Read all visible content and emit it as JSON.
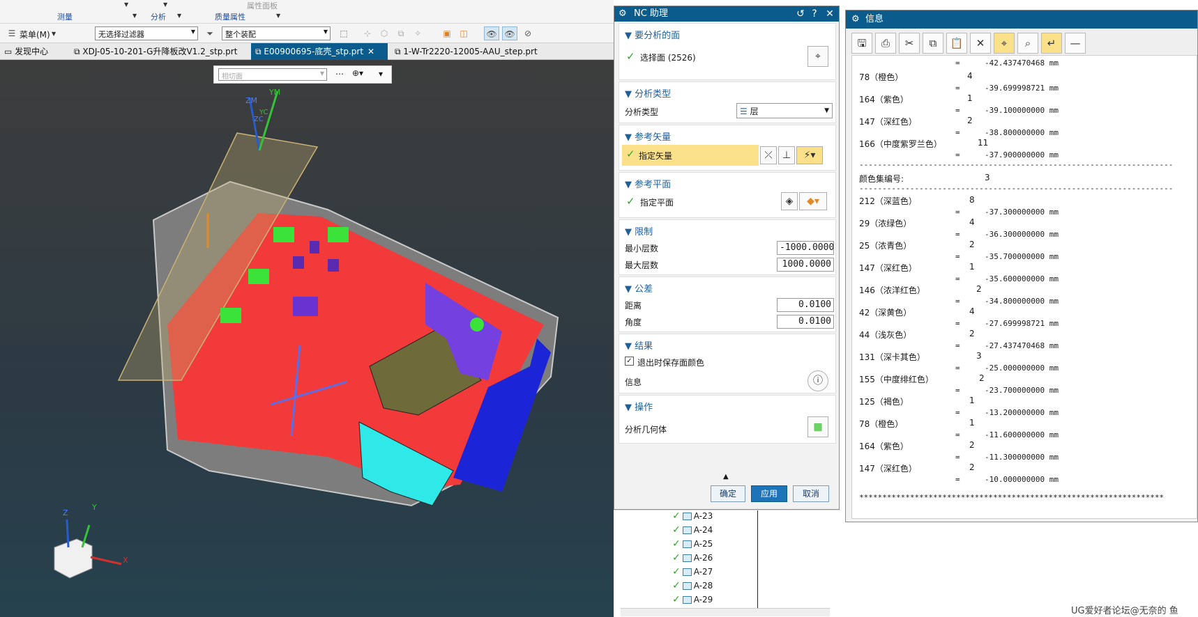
{
  "ribbon": {
    "groups": {
      "measure": "测量",
      "analysis": "分析",
      "mass": "质量属性",
      "props_panel": "属性面板"
    }
  },
  "toolbar": {
    "menu": "菜单(M)",
    "filter": "无选择过滤器",
    "assembly": "整个装配"
  },
  "tabs": [
    {
      "label": "发现中心"
    },
    {
      "label": "XDJ-05-10-201-G升降板改V1.2_stp.prt"
    },
    {
      "label": "E00900695-底壳_stp.prt"
    },
    {
      "label": "1-W-Tr2220-12005-AAU_step.prt"
    }
  ],
  "viewport": {
    "face_select": "相切面",
    "triad": {
      "zm": "ZM",
      "ym": "YM",
      "zc": "ZC",
      "yc": "YC",
      "x": "X",
      "y": "Y",
      "z": "Z"
    }
  },
  "nc_dialog": {
    "title": "NC 助理",
    "sec_faces": "要分析的面",
    "sel_faces": "选择面 (2526)",
    "sec_type": "分析类型",
    "type_label": "分析类型",
    "type_value": "层",
    "sec_vec": "参考矢量",
    "vec_label": "指定矢量",
    "sec_plane": "参考平面",
    "plane_label": "指定平面",
    "sec_limit": "限制",
    "min_label": "最小层数",
    "min_value": "-1000.0000",
    "max_label": "最大层数",
    "max_value": "1000.0000",
    "sec_tol": "公差",
    "dist_label": "距离",
    "dist_value": "0.0100",
    "ang_label": "角度",
    "ang_value": "0.0100",
    "sec_result": "结果",
    "save_color": "退出时保存面颜色",
    "info_label": "信息",
    "sec_ops": "操作",
    "analyze_geo": "分析几何体",
    "ok": "确定",
    "apply": "应用",
    "cancel": "取消"
  },
  "info_window": {
    "title": "信息",
    "top_lines": [
      {
        "name": "78（橙色）",
        "count": "4",
        "value": "-39.699998721 mm"
      },
      {
        "name": "164（紫色）",
        "count": "1",
        "value": "-39.100000000 mm"
      },
      {
        "name": "147（深红色）",
        "count": "2",
        "value": "-38.800000000 mm"
      },
      {
        "name": "166（中度紫罗兰色）",
        "count": "11",
        "value": "-37.900000000 mm"
      }
    ],
    "first_value": "-42.437470468 mm",
    "set_label": "颜色集编号:",
    "set_value": "3",
    "lines": [
      {
        "name": "212（深蓝色）",
        "count": "8",
        "value": "-37.300000000 mm"
      },
      {
        "name": "29（浓绿色）",
        "count": "4",
        "value": "-36.300000000 mm"
      },
      {
        "name": "25（浓青色）",
        "count": "2",
        "value": "-35.700000000 mm"
      },
      {
        "name": "147（深红色）",
        "count": "1",
        "value": "-35.600000000 mm"
      },
      {
        "name": "146（浓洋红色）",
        "count": "2",
        "value": "-34.800000000 mm"
      },
      {
        "name": "42（深黄色）",
        "count": "4",
        "value": "-27.699998721 mm"
      },
      {
        "name": "44（浅灰色）",
        "count": "2",
        "value": "-27.437470468 mm"
      },
      {
        "name": "131（深卡其色）",
        "count": "3",
        "value": "-25.000000000 mm"
      },
      {
        "name": "155（中度绯红色）",
        "count": "2",
        "value": "-23.700000000 mm"
      },
      {
        "name": "125（褐色）",
        "count": "1",
        "value": "-13.200000000 mm"
      },
      {
        "name": "78（橙色）",
        "count": "1",
        "value": "-11.600000000 mm"
      },
      {
        "name": "164（紫色）",
        "count": "2",
        "value": "-11.300000000 mm"
      },
      {
        "name": "147（深红色）",
        "count": "2",
        "value": "-10.000000000 mm"
      }
    ],
    "eq": "=",
    "dash_line": "--------------------------------------------------------------------",
    "star_line": "******************************************************************"
  },
  "tree": [
    "A-23",
    "A-24",
    "A-25",
    "A-26",
    "A-27",
    "A-28",
    "A-29"
  ],
  "watermark": "UG爱好者论坛@无奈的 鱼"
}
